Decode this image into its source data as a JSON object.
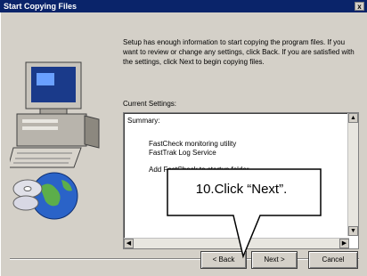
{
  "window": {
    "title": "Start Copying Files",
    "close_glyph": "x"
  },
  "intro_text": "Setup has enough information to start copying the program files. If you want to review or change any settings, click Back. If you are satisfied with the settings, click Next to begin copying files.",
  "current_settings_label": "Current Settings:",
  "summary": {
    "heading": "Summary:",
    "items": [
      "FastCheck monitoring utility",
      "FastTrak Log Service",
      "Add FastCheck to startup folder"
    ]
  },
  "callout": {
    "text": "10.Click “Next”."
  },
  "buttons": {
    "back": "< Back",
    "next": "Next >",
    "cancel": "Cancel"
  },
  "icons": [
    "computer-icon",
    "globe-icon",
    "cd-icon",
    "close-icon",
    "scroll-up-icon",
    "scroll-down-icon",
    "scroll-left-icon",
    "scroll-right-icon"
  ],
  "colors": {
    "title_bar": "#0a246a",
    "dialog_face": "#d4d0c8"
  }
}
